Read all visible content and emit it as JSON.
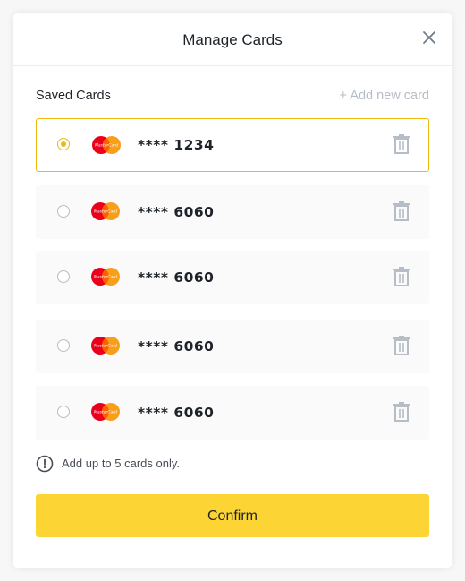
{
  "modal": {
    "title": "Manage Cards",
    "close_icon": "close-icon"
  },
  "saved_cards_label": "Saved Cards",
  "add_new_card_label": "+ Add new card",
  "cards": [
    {
      "number": "**** 1234",
      "selected": true,
      "brand": "MasterCard"
    },
    {
      "number": "**** 6060",
      "selected": false,
      "brand": "MasterCard"
    },
    {
      "number": "**** 6060",
      "selected": false,
      "brand": "MasterCard"
    },
    {
      "number": "**** 6060",
      "selected": false,
      "brand": "MasterCard"
    },
    {
      "number": "**** 6060",
      "selected": false,
      "brand": "MasterCard"
    }
  ],
  "note": "Add up to 5 cards only.",
  "confirm_label": "Confirm",
  "colors": {
    "accent": "#f0b90b",
    "confirm_bg": "#fcd535",
    "muted": "#b7bdc6",
    "text": "#1e2329"
  }
}
